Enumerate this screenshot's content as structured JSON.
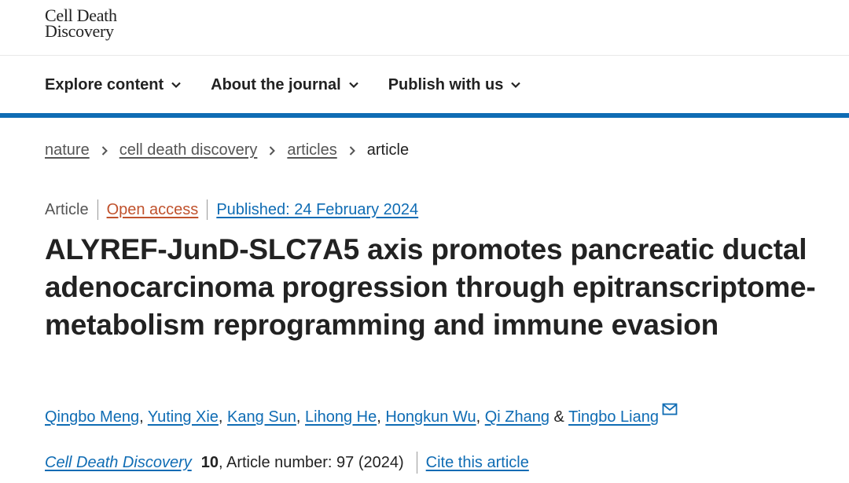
{
  "header": {
    "logo_line1": "Cell Death",
    "logo_line2": "Discovery"
  },
  "nav": {
    "items": [
      {
        "label": "Explore content",
        "icon": "chevron-down-icon"
      },
      {
        "label": "About the journal",
        "icon": "chevron-down-icon"
      },
      {
        "label": "Publish with us",
        "icon": "chevron-down-icon"
      }
    ]
  },
  "colors": {
    "accent": "#0f6cb4",
    "open_access": "#c0522d",
    "text": "#222222"
  },
  "breadcrumb": {
    "items": [
      "nature",
      "cell death discovery",
      "articles"
    ],
    "current": "article"
  },
  "article": {
    "type": "Article",
    "access": "Open access",
    "published": "Published: 24 February 2024",
    "title": "ALYREF-JunD-SLC7A5 axis promotes pancreatic ductal adenocarcinoma progression through epitranscriptome-metabolism reprogramming and immune evasion",
    "authors": [
      "Qingbo Meng",
      "Yuting Xie",
      "Kang Sun",
      "Lihong He",
      "Hongkun Wu",
      "Qi Zhang",
      "Tingbo Liang"
    ],
    "author_separator": ", ",
    "author_last_joiner": " & ",
    "corresponding_icon": "mail-icon"
  },
  "citation": {
    "journal": "Cell Death Discovery",
    "volume": "10",
    "article_number": ", Article number: 97 (2024)",
    "cite_label": "Cite this article"
  }
}
